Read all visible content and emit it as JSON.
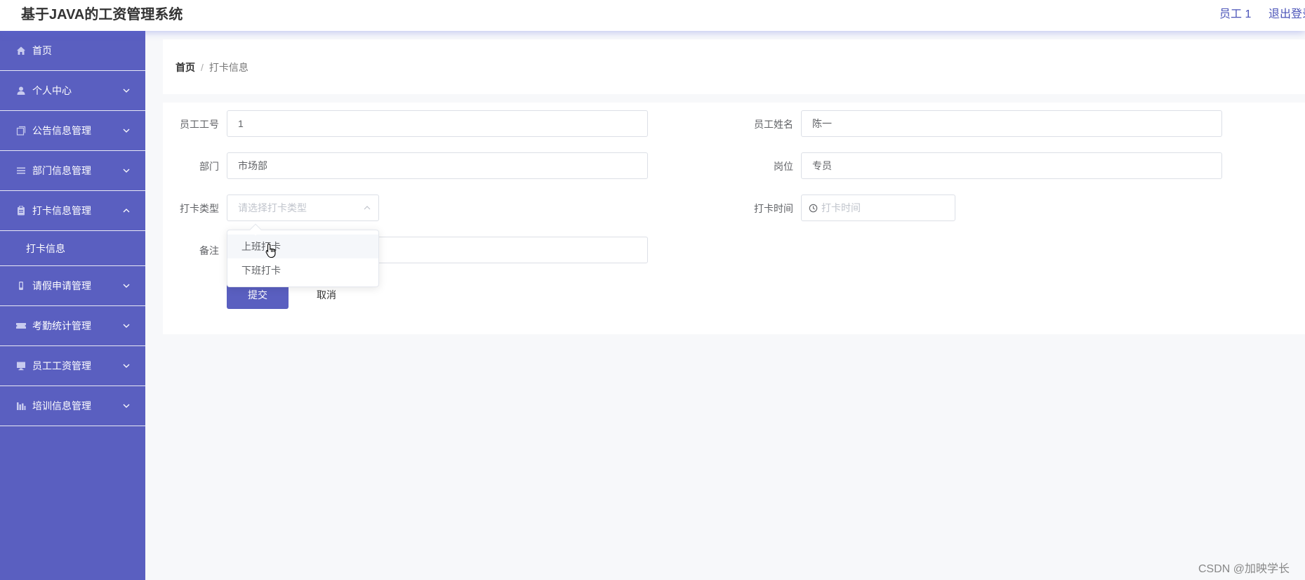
{
  "header": {
    "title": "基于JAVA的工资管理系统",
    "user": "员工 1",
    "logout": "退出登录"
  },
  "sidebar": {
    "items": [
      {
        "label": "首页",
        "icon": "home-icon"
      },
      {
        "label": "个人中心",
        "icon": "user-icon"
      },
      {
        "label": "公告信息管理",
        "icon": "copy-icon"
      },
      {
        "label": "部门信息管理",
        "icon": "list-icon"
      },
      {
        "label": "打卡信息管理",
        "icon": "clipboard-icon",
        "expanded": true,
        "children": [
          {
            "label": "打卡信息"
          }
        ]
      },
      {
        "label": "请假申请管理",
        "icon": "phone-icon"
      },
      {
        "label": "考勤统计管理",
        "icon": "ticket-icon"
      },
      {
        "label": "员工工资管理",
        "icon": "monitor-icon"
      },
      {
        "label": "培训信息管理",
        "icon": "chart-icon"
      }
    ]
  },
  "breadcrumb": {
    "home": "首页",
    "separator": "/",
    "current": "打卡信息"
  },
  "form": {
    "employee_id": {
      "label": "员工工号",
      "value": "1"
    },
    "employee_name": {
      "label": "员工姓名",
      "value": "陈一"
    },
    "department": {
      "label": "部门",
      "value": "市场部"
    },
    "position": {
      "label": "岗位",
      "value": "专员"
    },
    "punch_type": {
      "label": "打卡类型",
      "placeholder": "请选择打卡类型"
    },
    "punch_time": {
      "label": "打卡时间",
      "placeholder": "打卡时间"
    },
    "remark": {
      "label": "备注",
      "value": ""
    },
    "submit": "提交",
    "cancel": "取消"
  },
  "dropdown": {
    "options": [
      "上班打卡",
      "下班打卡"
    ]
  },
  "watermark": "CSDN @加映学长",
  "colors": {
    "primary": "#5a5fc0",
    "sidebar_bg": "#5a5fc0",
    "page_bg": "#f7f8fa"
  }
}
